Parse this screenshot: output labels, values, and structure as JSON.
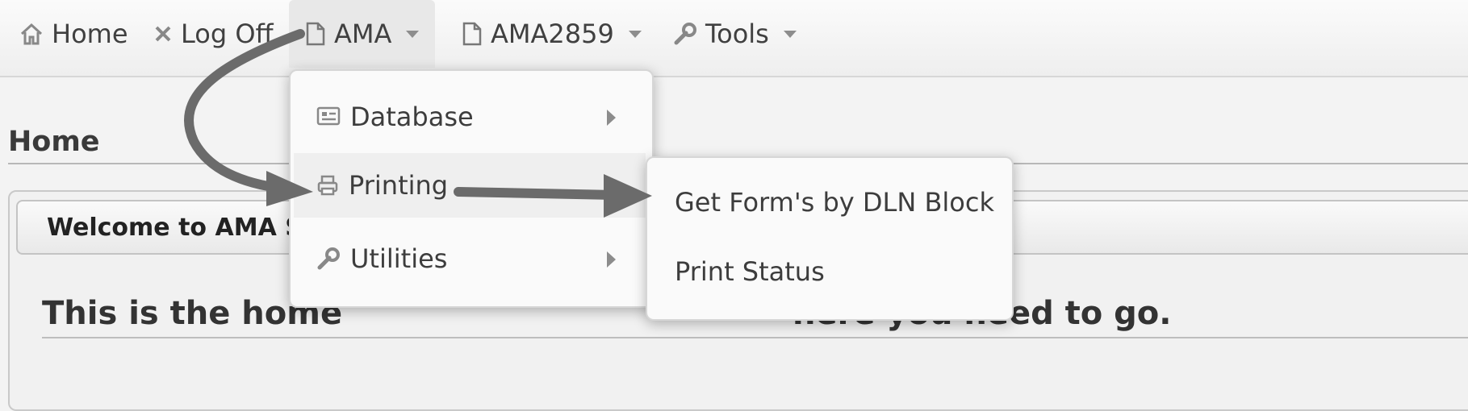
{
  "menubar": {
    "items": [
      {
        "label": "Home",
        "icon": "home-icon"
      },
      {
        "label": "Log Off",
        "icon": "close-icon"
      },
      {
        "label": "AMA",
        "icon": "document-icon"
      },
      {
        "label": "AMA2859",
        "icon": "document-icon"
      },
      {
        "label": "Tools",
        "icon": "wrench-icon"
      }
    ]
  },
  "page": {
    "heading": "Home",
    "panel_header": "Welcome to AMA S",
    "message_start": "This is the home",
    "message_end": "here you need to go."
  },
  "ama_menu": {
    "items": [
      {
        "label": "Database",
        "icon": "database-icon"
      },
      {
        "label": "Printing",
        "icon": "printer-icon"
      },
      {
        "label": "Utilities",
        "icon": "wrench-icon"
      }
    ]
  },
  "printing_submenu": {
    "items": [
      {
        "label": "Get Form's by DLN Block"
      },
      {
        "label": "Print Status"
      }
    ]
  },
  "colors": {
    "annotation_arrow": "#6b6b6b",
    "menubar_bg": "#f5f5f5",
    "text": "#3d3d3d"
  }
}
